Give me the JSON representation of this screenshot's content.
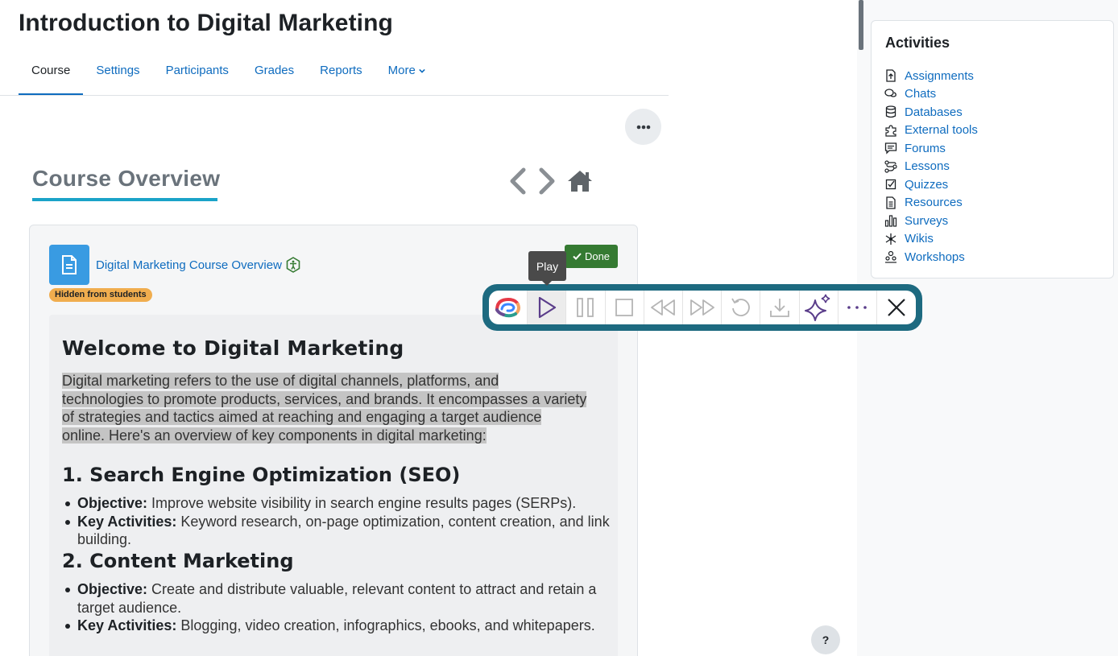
{
  "course": {
    "title": "Introduction to Digital Marketing"
  },
  "tabs": [
    {
      "label": "Course"
    },
    {
      "label": "Settings"
    },
    {
      "label": "Participants"
    },
    {
      "label": "Grades"
    },
    {
      "label": "Reports"
    },
    {
      "label": "More"
    }
  ],
  "overview": {
    "title": "Course Overview"
  },
  "activity": {
    "name": "Digital Marketing Course Overview",
    "hidden_badge": "Hidden from students",
    "done_label": "Done"
  },
  "content": {
    "heading": "Welcome to Digital Marketing",
    "intro_lines": [
      "Digital marketing refers to the use of digital channels, platforms, and",
      "technologies to promote products, services, and brands. It encompasses a variety",
      "of strategies and tactics aimed at reaching and engaging a target audience",
      "online. Here's an overview of key components in digital marketing:"
    ],
    "sections": [
      {
        "heading": "1. Search Engine Optimization (SEO)",
        "items": [
          {
            "label": "Objective:",
            "text": " Improve website visibility in search engine results pages (SERPs)."
          },
          {
            "label": "Key Activities:",
            "text": " Keyword research, on-page optimization, content creation, and link building."
          }
        ]
      },
      {
        "heading": "2. Content Marketing",
        "items": [
          {
            "label": "Objective:",
            "text": " Create and distribute valuable, relevant content to attract and retain a target audience."
          },
          {
            "label": "Key Activities:",
            "text": " Blogging, video creation, infographics, ebooks, and whitepapers."
          }
        ]
      }
    ]
  },
  "tts": {
    "tooltip": "Play",
    "buttons": [
      "logo-icon",
      "play-icon",
      "pause-icon",
      "stop-icon",
      "rewind-icon",
      "fast-forward-icon",
      "restart-icon",
      "download-icon",
      "sparkle-icon",
      "more-icon",
      "close-icon"
    ]
  },
  "drawer": {
    "title": "Activities",
    "items": [
      {
        "label": "Assignments",
        "icon": "assignment-icon"
      },
      {
        "label": "Chats",
        "icon": "chat-icon"
      },
      {
        "label": "Databases",
        "icon": "database-icon"
      },
      {
        "label": "External tools",
        "icon": "puzzle-icon"
      },
      {
        "label": "Forums",
        "icon": "forum-icon"
      },
      {
        "label": "Lessons",
        "icon": "lesson-icon"
      },
      {
        "label": "Quizzes",
        "icon": "quiz-icon"
      },
      {
        "label": "Resources",
        "icon": "resource-icon"
      },
      {
        "label": "Surveys",
        "icon": "survey-icon"
      },
      {
        "label": "Wikis",
        "icon": "wiki-icon"
      },
      {
        "label": "Workshops",
        "icon": "workshop-icon"
      }
    ]
  },
  "help": {
    "label": "?"
  },
  "colors": {
    "link": "#0f6cbf",
    "toolbar_border": "#1d6a80",
    "done": "#357a32",
    "badge": "#f0ad4e"
  }
}
